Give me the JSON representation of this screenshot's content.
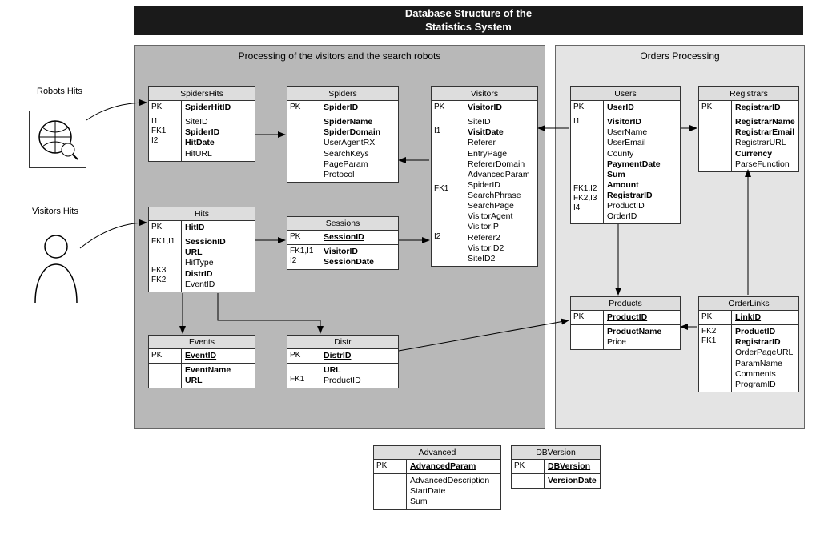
{
  "title_line1": "Database Structure of the",
  "title_line2": "Statistics System",
  "region_left_title": "Processing of the visitors and the search robots",
  "region_right_title": "Orders Processing",
  "label_robots": "Robots Hits",
  "label_visitors": "Visitors Hits",
  "tables": {
    "spidershits": {
      "name": "SpidersHits",
      "sections": [
        {
          "key": "PK",
          "cols": [
            {
              "t": "SpiderHitID",
              "cls": "pk"
            }
          ]
        },
        {
          "key": "I1\nFK1\nI2",
          "cols": [
            {
              "t": "SiteID"
            },
            {
              "t": "SpiderID",
              "cls": "b"
            },
            {
              "t": "HitDate",
              "cls": "b"
            },
            {
              "t": "HitURL"
            }
          ]
        }
      ]
    },
    "spiders": {
      "name": "Spiders",
      "sections": [
        {
          "key": "PK",
          "cols": [
            {
              "t": "SpiderID",
              "cls": "pk"
            }
          ]
        },
        {
          "key": "",
          "cols": [
            {
              "t": "SpiderName",
              "cls": "b"
            },
            {
              "t": "SpiderDomain",
              "cls": "b"
            },
            {
              "t": "UserAgentRX"
            },
            {
              "t": "SearchKeys"
            },
            {
              "t": "PageParam"
            },
            {
              "t": "Protocol"
            }
          ]
        }
      ]
    },
    "visitors": {
      "name": "Visitors",
      "sections": [
        {
          "key": "PK",
          "cols": [
            {
              "t": "VisitorID",
              "cls": "pk"
            }
          ]
        },
        {
          "key": "\nI1\n\n\n\n\n\nFK1\n\n\n\n\nI2",
          "cols": [
            {
              "t": "SiteID"
            },
            {
              "t": "VisitDate",
              "cls": "b"
            },
            {
              "t": "Referer"
            },
            {
              "t": "EntryPage"
            },
            {
              "t": "RefererDomain"
            },
            {
              "t": "AdvancedParam"
            },
            {
              "t": "SpiderID"
            },
            {
              "t": "SearchPhrase"
            },
            {
              "t": "SearchPage"
            },
            {
              "t": "VisitorAgent"
            },
            {
              "t": "VisitorIP"
            },
            {
              "t": "Referer2"
            },
            {
              "t": "VisitorID2"
            },
            {
              "t": "SiteID2"
            }
          ]
        }
      ]
    },
    "hits": {
      "name": "Hits",
      "sections": [
        {
          "key": "PK",
          "cols": [
            {
              "t": "HitID",
              "cls": "pk"
            }
          ]
        },
        {
          "key": "FK1,I1\n\n\nFK3\nFK2",
          "cols": [
            {
              "t": "SessionID",
              "cls": "b"
            },
            {
              "t": "URL",
              "cls": "b"
            },
            {
              "t": "HitType"
            },
            {
              "t": "DistrID",
              "cls": "b"
            },
            {
              "t": "EventID"
            }
          ]
        }
      ]
    },
    "sessions": {
      "name": "Sessions",
      "sections": [
        {
          "key": "PK",
          "cols": [
            {
              "t": "SessionID",
              "cls": "pk"
            }
          ]
        },
        {
          "key": "FK1,I1\nI2",
          "cols": [
            {
              "t": "VisitorID",
              "cls": "b"
            },
            {
              "t": "SessionDate",
              "cls": "b"
            }
          ]
        }
      ]
    },
    "events": {
      "name": "Events",
      "sections": [
        {
          "key": "PK",
          "cols": [
            {
              "t": "EventID",
              "cls": "pk"
            }
          ]
        },
        {
          "key": "",
          "cols": [
            {
              "t": "EventName",
              "cls": "b"
            },
            {
              "t": "URL",
              "cls": "b"
            }
          ]
        }
      ]
    },
    "distr": {
      "name": "Distr",
      "sections": [
        {
          "key": "PK",
          "cols": [
            {
              "t": "DistrID",
              "cls": "pk"
            }
          ]
        },
        {
          "key": "\nFK1",
          "cols": [
            {
              "t": "URL",
              "cls": "b"
            },
            {
              "t": "ProductID"
            }
          ]
        }
      ]
    },
    "users": {
      "name": "Users",
      "sections": [
        {
          "key": "PK",
          "cols": [
            {
              "t": "UserID",
              "cls": "pk"
            }
          ]
        },
        {
          "key": "I1\n\n\n\n\n\n\nFK1,I2\nFK2,I3\nI4",
          "cols": [
            {
              "t": "VisitorID",
              "cls": "b"
            },
            {
              "t": "UserName"
            },
            {
              "t": "UserEmail"
            },
            {
              "t": "County"
            },
            {
              "t": "PaymentDate",
              "cls": "b"
            },
            {
              "t": "Sum",
              "cls": "b"
            },
            {
              "t": "Amount",
              "cls": "b"
            },
            {
              "t": "RegistrarID",
              "cls": "b"
            },
            {
              "t": "ProductID"
            },
            {
              "t": "OrderID"
            }
          ]
        }
      ]
    },
    "registrars": {
      "name": "Registrars",
      "sections": [
        {
          "key": "PK",
          "cols": [
            {
              "t": "RegistrarID",
              "cls": "pk"
            }
          ]
        },
        {
          "key": "",
          "cols": [
            {
              "t": "RegistrarName",
              "cls": "b"
            },
            {
              "t": "RegistrarEmail",
              "cls": "b"
            },
            {
              "t": "RegistrarURL"
            },
            {
              "t": "Currency",
              "cls": "b"
            },
            {
              "t": "ParseFunction"
            }
          ]
        }
      ]
    },
    "products": {
      "name": "Products",
      "sections": [
        {
          "key": "PK",
          "cols": [
            {
              "t": "ProductID",
              "cls": "pk"
            }
          ]
        },
        {
          "key": "",
          "cols": [
            {
              "t": "ProductName",
              "cls": "b"
            },
            {
              "t": "Price"
            }
          ]
        }
      ]
    },
    "orderlinks": {
      "name": "OrderLinks",
      "sections": [
        {
          "key": "PK",
          "cols": [
            {
              "t": "LinkID",
              "cls": "pk"
            }
          ]
        },
        {
          "key": "FK2\nFK1",
          "cols": [
            {
              "t": "ProductID",
              "cls": "b"
            },
            {
              "t": "RegistrarID",
              "cls": "b"
            },
            {
              "t": "OrderPageURL"
            },
            {
              "t": "ParamName"
            },
            {
              "t": "Comments"
            },
            {
              "t": "ProgramID"
            }
          ]
        }
      ]
    },
    "advanced": {
      "name": "Advanced",
      "sections": [
        {
          "key": "PK",
          "cols": [
            {
              "t": "AdvancedParam",
              "cls": "pk"
            }
          ]
        },
        {
          "key": "",
          "cols": [
            {
              "t": "AdvancedDescription"
            },
            {
              "t": "StartDate"
            },
            {
              "t": "Sum"
            }
          ]
        }
      ]
    },
    "dbversion": {
      "name": "DBVersion",
      "sections": [
        {
          "key": "PK",
          "cols": [
            {
              "t": "DBVersion",
              "cls": "pk"
            }
          ]
        },
        {
          "key": "",
          "cols": [
            {
              "t": "VersionDate",
              "cls": "b"
            }
          ]
        }
      ]
    }
  }
}
